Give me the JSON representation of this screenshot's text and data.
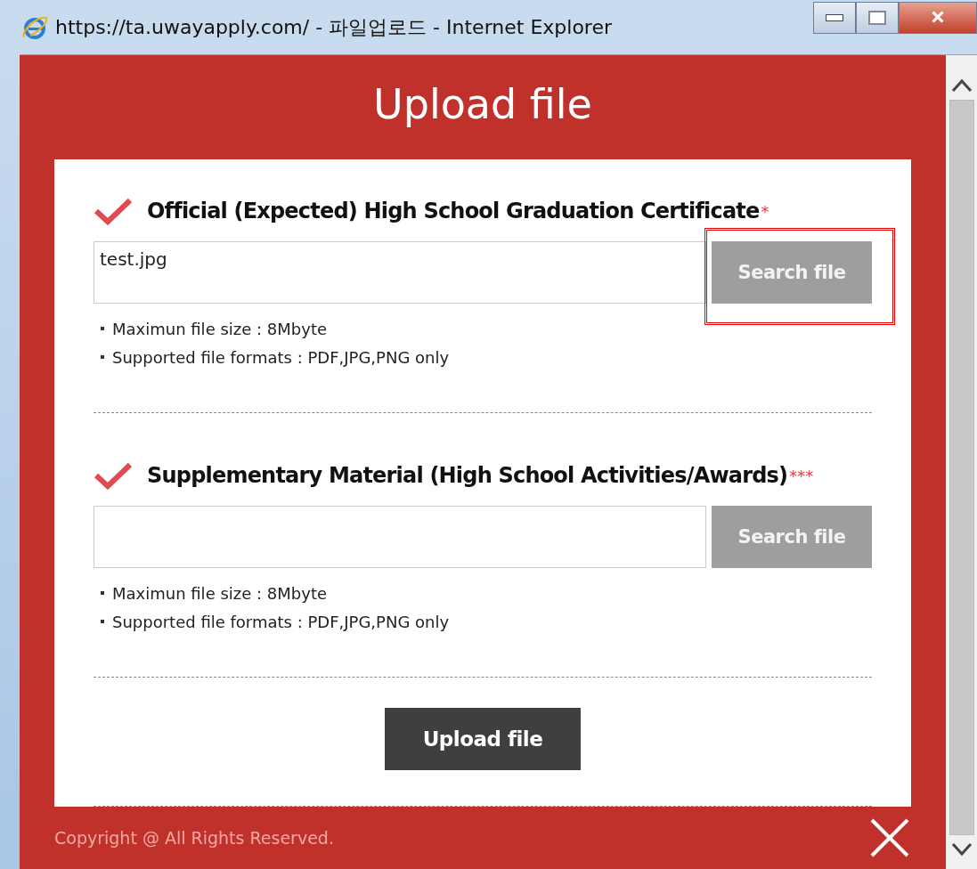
{
  "window": {
    "title": "https://ta.uwayapply.com/ - 파일업로드 - Internet Explorer"
  },
  "heading": "Upload file",
  "sections": [
    {
      "title": "Official (Expected) High School Graduation Certificate",
      "required_mark": "*",
      "file_value": "test.jpg",
      "button": "Search file",
      "highlighted": true,
      "notes": [
        "Maximun file size : 8Mbyte",
        "Supported file formats : PDF,JPG,PNG only"
      ]
    },
    {
      "title": "Supplementary Material (High School Activities/Awards)",
      "required_mark": "***",
      "button": "Search file",
      "highlighted": false,
      "notes": [
        "Maximun file size : 8Mbyte",
        "Supported file formats : PDF,JPG,PNG only"
      ]
    }
  ],
  "upload_button": "Upload file",
  "footer": "Copyright @ All Rights Reserved."
}
